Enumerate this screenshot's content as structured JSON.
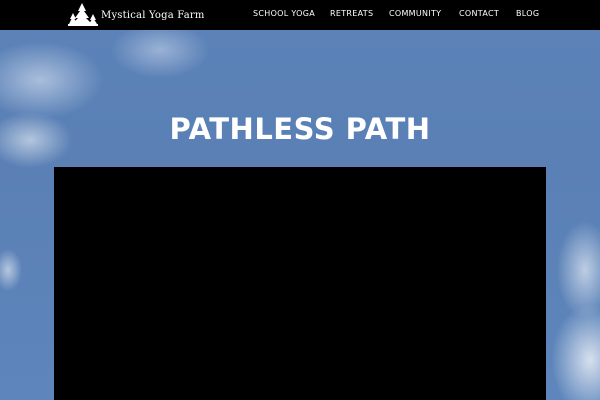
{
  "site": {
    "logo_text": "Mystical Yoga Farm",
    "logo_icon": "pine-trees-icon"
  },
  "nav": {
    "items": [
      {
        "label": "SCHOOL YOGA"
      },
      {
        "label": "RETREATS"
      },
      {
        "label": "COMMUNITY"
      },
      {
        "label": "CONTACT"
      },
      {
        "label": "BLOG"
      }
    ]
  },
  "hero": {
    "title": "PATHLESS PATH"
  },
  "colors": {
    "nav_background": "#000000",
    "sky": "#5a82b8",
    "text": "#ffffff",
    "video_background": "#000000"
  }
}
